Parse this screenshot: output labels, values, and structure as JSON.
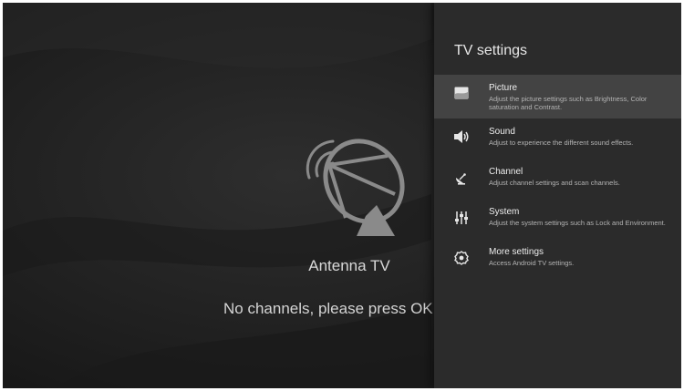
{
  "background": {
    "source_title": "Antenna TV",
    "message": "No channels, please press OK to"
  },
  "panel": {
    "title": "TV settings",
    "items": [
      {
        "label": "Picture",
        "description": "Adjust the picture settings such as Brightness, Color saturation and Contrast.",
        "icon": "picture-icon",
        "selected": true
      },
      {
        "label": "Sound",
        "description": "Adjust to experience the different sound effects.",
        "icon": "speaker-icon",
        "selected": false
      },
      {
        "label": "Channel",
        "description": "Adjust channel settings and scan channels.",
        "icon": "satellite-dish-icon",
        "selected": false
      },
      {
        "label": "System",
        "description": "Adjust the system settings such as Lock and Environment.",
        "icon": "sliders-icon",
        "selected": false
      },
      {
        "label": "More settings",
        "description": "Access Android TV settings.",
        "icon": "gear-icon",
        "selected": false
      }
    ]
  },
  "colors": {
    "panel_bg": "#2b2b2b",
    "selected_bg": "#434343",
    "text_primary": "#eeeeee",
    "text_secondary": "#b4b4b4"
  }
}
